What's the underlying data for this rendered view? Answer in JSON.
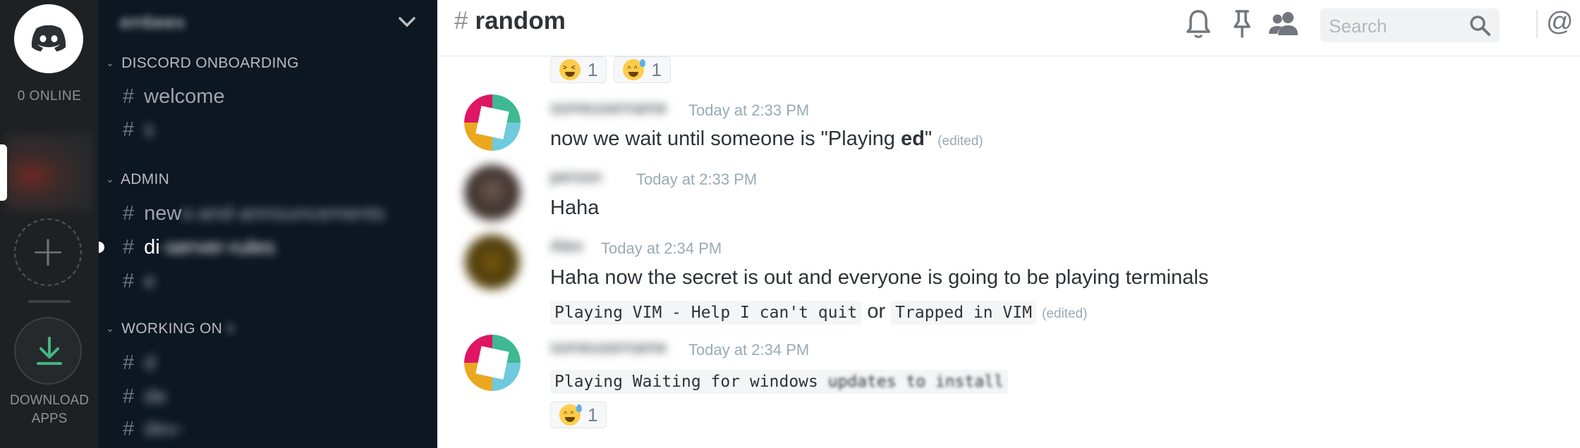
{
  "rail": {
    "online_label": "0 ONLINE",
    "add_symbol": "+",
    "download_line1": "DOWNLOAD",
    "download_line2": "APPS"
  },
  "sidebar": {
    "server_name": "embeex",
    "categories": [
      {
        "label": "DISCORD ONBOARDING",
        "channels": [
          "welcome",
          "s"
        ]
      },
      {
        "label": "ADMIN",
        "channels": [
          "new",
          "discord-server-rules",
          "e"
        ]
      },
      {
        "label": "WORKING ON",
        "label_tail": "it",
        "channels": [
          "d",
          "de",
          "dev-"
        ]
      }
    ],
    "admin_new_tail": "s-and-announcements",
    "active_channel_tail": "-server-rules"
  },
  "header": {
    "hash": "#",
    "channel": "random",
    "search_placeholder": "Search",
    "mention_symbol": "@"
  },
  "messages": {
    "top_reactions": [
      {
        "emoji": "tired-face",
        "count": "1"
      },
      {
        "emoji": "sweat-smile",
        "count": "1"
      }
    ],
    "m1": {
      "author": "someusername",
      "time": "Today at 2:33 PM",
      "text_pre": "now we wait until someone is \"Playing ",
      "text_bold": "ed",
      "text_post": "\"",
      "edited": "(edited)"
    },
    "m2": {
      "author": "person",
      "time": "Today at 2:33 PM",
      "text": "Haha"
    },
    "m3": {
      "author": "Alex",
      "time": "Today at 2:34 PM",
      "text": "Haha now the secret is out and everyone is going to be playing terminals",
      "code1": "Playing VIM - Help I can't quit",
      "or": "or",
      "code2": "Trapped in VIM",
      "edited": "(edited)"
    },
    "m4": {
      "author": "someusername",
      "time": "Today at 2:34 PM",
      "code_visible": "Playing Waiting for windows",
      "code_blurred": "updates to install",
      "reaction": {
        "emoji": "sweat-smile",
        "count": "1"
      }
    }
  },
  "colors": {
    "rail_bg": "#1e2124",
    "sidebar_bg": "#0d1722",
    "text_dark": "#2e3338",
    "timestamp": "#99aab5",
    "download_green": "#43b581"
  }
}
